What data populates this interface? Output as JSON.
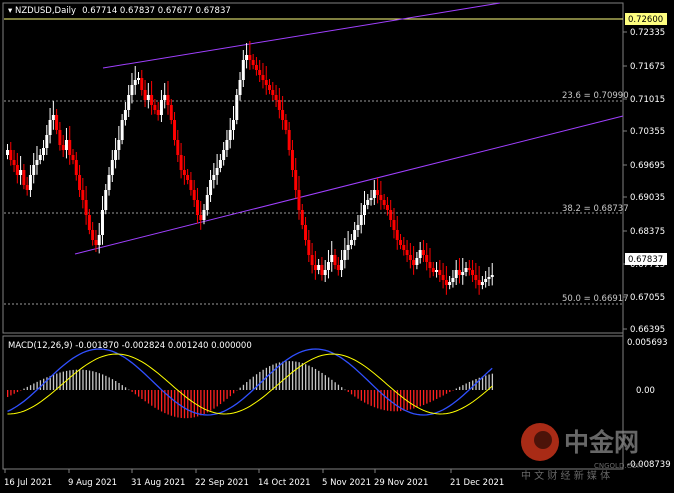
{
  "header": {
    "symbol_timeframe": "NZDUSD,Daily",
    "ohlc": "0.67714 0.67837 0.67677 0.67837"
  },
  "price_axis": {
    "labels": [
      "0.72335",
      "0.71675",
      "0.71015",
      "0.70355",
      "0.69695",
      "0.69035",
      "0.68375",
      "0.67715",
      "0.67055",
      "0.66395"
    ],
    "current_price": "0.67837",
    "hline_price": "0.72600"
  },
  "fib_levels": [
    {
      "label": "23.6 = 0.70990",
      "price": 0.7099
    },
    {
      "label": "38.2 = 0.68737",
      "price": 0.68737
    },
    {
      "label": "50.0 = 0.66917",
      "price": 0.66917
    }
  ],
  "macd": {
    "title": "MACD(12,26,9) -0.001870 -0.002824 0.001240 0.000000",
    "axis_labels": {
      "top": "0.005693",
      "zero": "0.00",
      "bottom": "-0.008739"
    }
  },
  "time_axis": {
    "labels": [
      "16 Jul 2021",
      "9 Aug 2021",
      "31 Aug 2021",
      "22 Sep 2021",
      "14 Oct 2021",
      "5 Nov 2021",
      "29 Nov 2021",
      "21 Dec 2021"
    ]
  },
  "watermark": {
    "brand_cn": "中金网",
    "brand_en": "CNGOLD.COM",
    "tagline_cn": "中 文 财 经 新 媒 体"
  },
  "colors": {
    "background": "#000000",
    "bull": "#ffffff",
    "bear": "#ff0000",
    "channel": "#a040ff",
    "hline": "#ffff80",
    "macd_hist_pos": "#c8c8c8",
    "macd_hist_neg": "#ff2020",
    "macd_signal": "#ffff00",
    "macd_main": "#3050ff"
  }
}
